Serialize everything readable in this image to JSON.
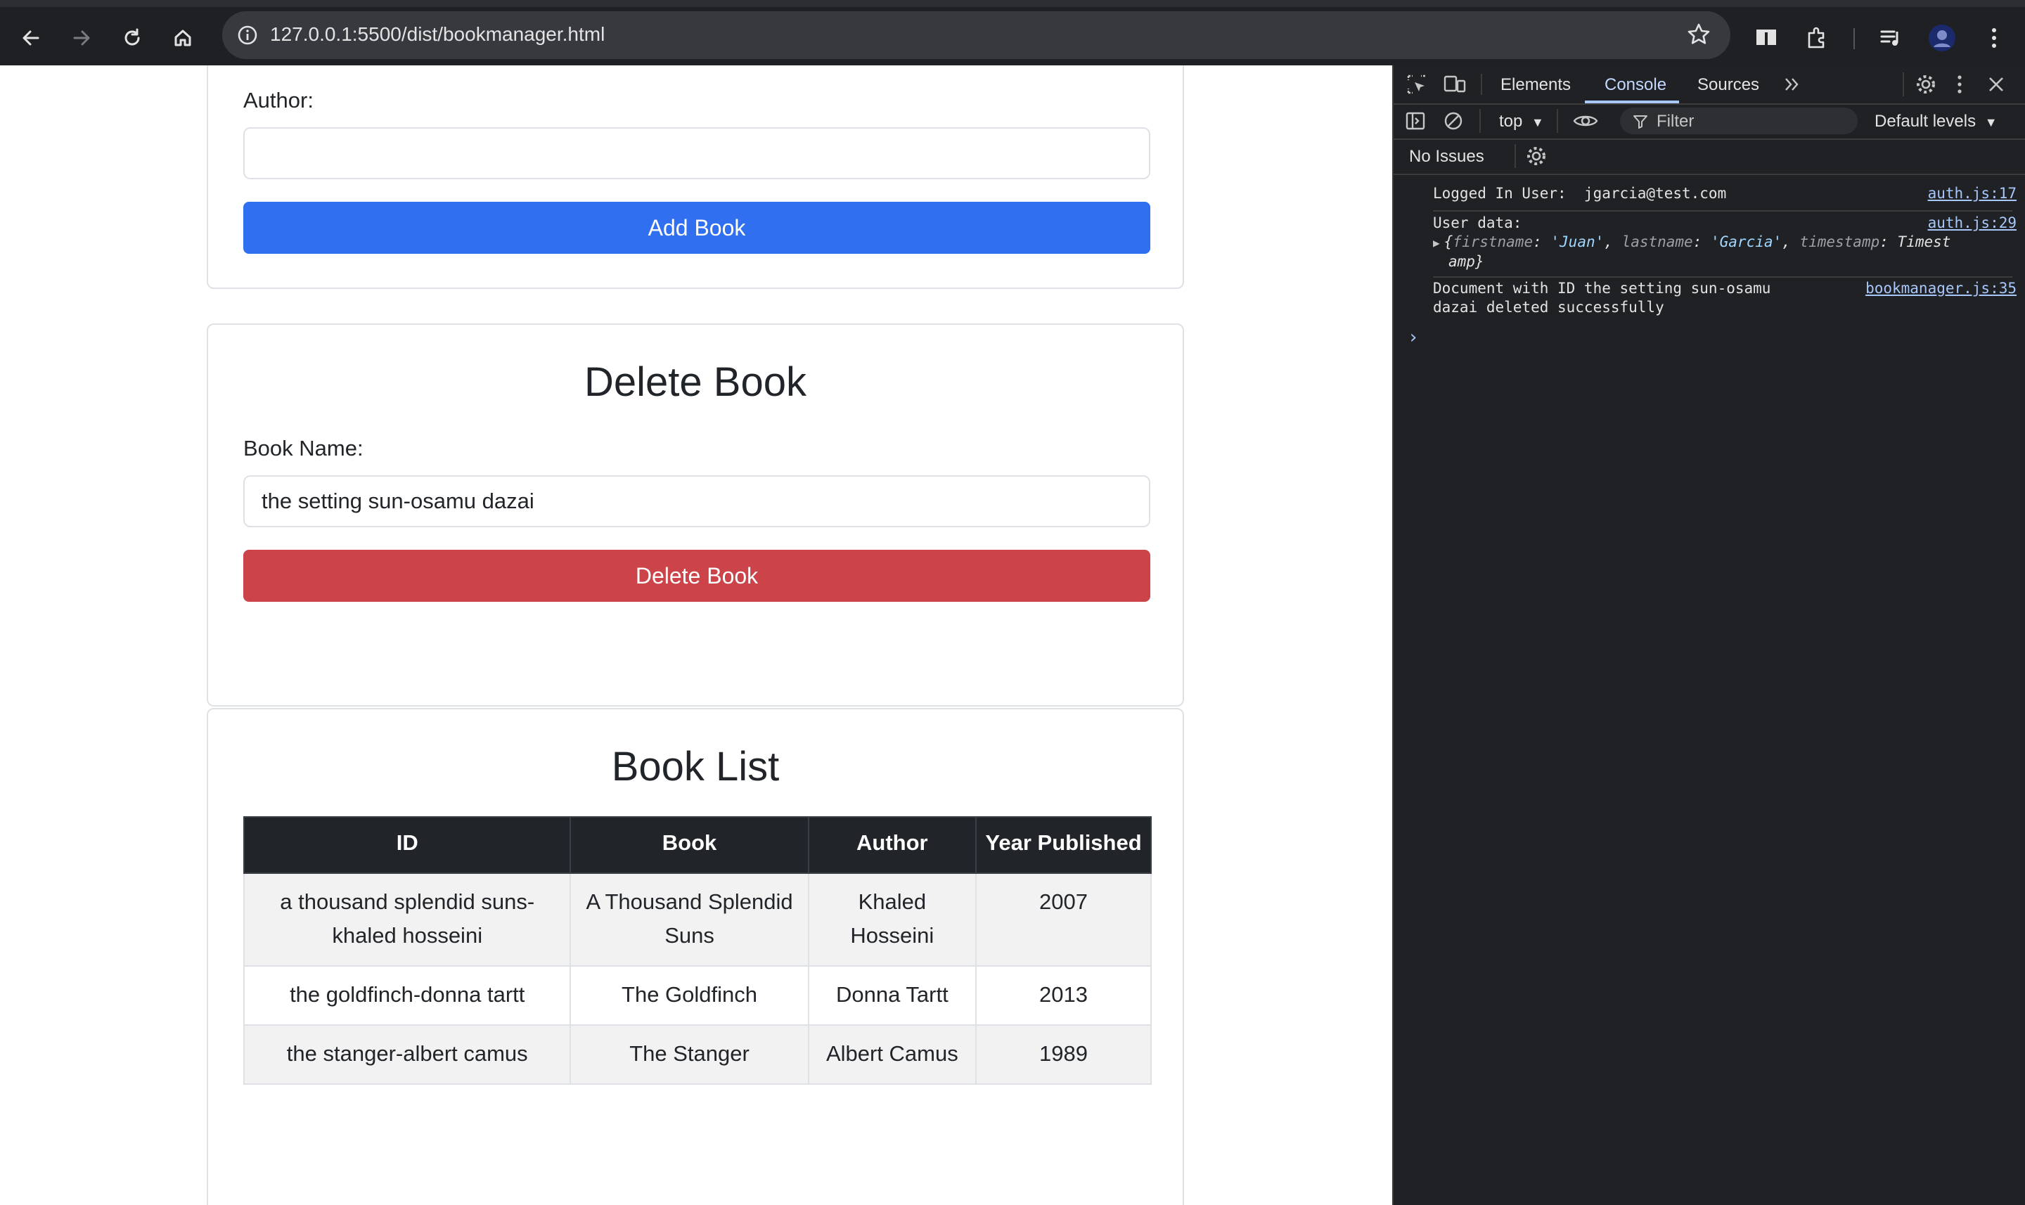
{
  "browser": {
    "url": "127.0.0.1:5500/dist/bookmanager.html"
  },
  "add_form": {
    "author_label": "Author:",
    "author_value": "",
    "submit_label": "Add Book"
  },
  "delete_form": {
    "title": "Delete Book",
    "book_name_label": "Book Name:",
    "book_name_value": "the setting sun-osamu dazai",
    "submit_label": "Delete Book"
  },
  "book_list": {
    "title": "Book List",
    "headers": [
      "ID",
      "Book",
      "Author",
      "Year Published"
    ],
    "rows": [
      {
        "id": "a thousand splendid suns-khaled hosseini",
        "book": "A Thousand Splendid Suns",
        "author": "Khaled Hosseini",
        "year": "2007"
      },
      {
        "id": "the goldfinch-donna tartt",
        "book": "The Goldfinch",
        "author": "Donna Tartt",
        "year": "2013"
      },
      {
        "id": "the stanger-albert camus",
        "book": "The Stanger",
        "author": "Albert Camus",
        "year": "1989"
      }
    ]
  },
  "devtools": {
    "tabs": [
      "Elements",
      "Console",
      "Sources"
    ],
    "active_tab": "Console",
    "context": "top",
    "filter_placeholder": "Filter",
    "levels": "Default levels",
    "issues": "No Issues",
    "logs": [
      {
        "text": "Logged In User:  jgarcia@test.com",
        "source": "auth.js:17"
      },
      {
        "text": "User data:",
        "source": "auth.js:29",
        "object": {
          "k1": "firstname",
          "v1": "'Juan'",
          "k2": "lastname",
          "v2": "'Garcia'",
          "k3": "timestamp",
          "v3": "Timest",
          "cont": "amp}"
        }
      },
      {
        "text": "Document with ID the setting sun-osamu",
        "text2": "dazai deleted successfully",
        "source": "bookmanager.js:35"
      }
    ],
    "prompt": "›"
  },
  "colors": {
    "primary": "#2f6ff0",
    "danger": "#cc4349",
    "table_header": "#212529"
  }
}
